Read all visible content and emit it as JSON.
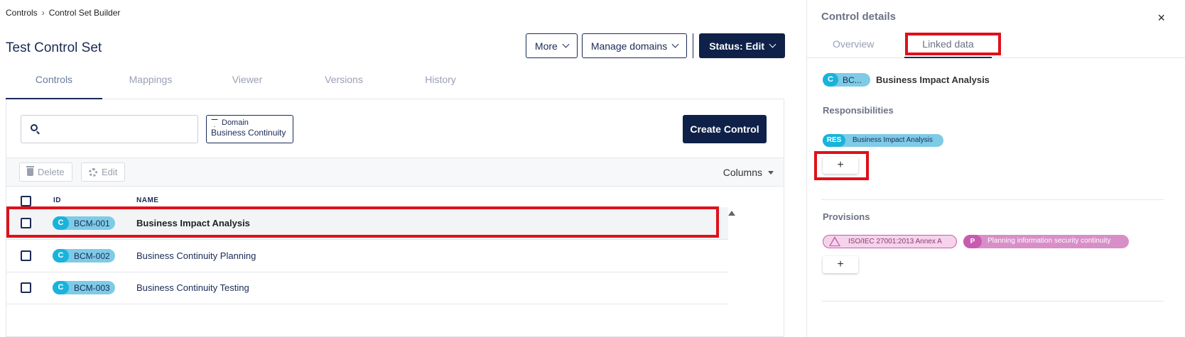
{
  "breadcrumb": {
    "root": "Controls",
    "current": "Control Set Builder"
  },
  "page": {
    "title": "Test Control Set"
  },
  "header_buttons": {
    "more": "More",
    "manage_domains": "Manage domains",
    "status": "Status: Edit"
  },
  "tabs": [
    "Controls",
    "Mappings",
    "Viewer",
    "Versions",
    "History"
  ],
  "filters": {
    "search_placeholder": "",
    "domain_label": "Domain",
    "domain_value": "Business Continuity"
  },
  "actions": {
    "create": "Create Control",
    "delete": "Delete",
    "edit": "Edit",
    "columns": "Columns"
  },
  "table": {
    "headers": {
      "id": "ID",
      "name": "NAME"
    },
    "rows": [
      {
        "badge": "C",
        "id": "BCM-001",
        "name": "Business Impact Analysis",
        "selected": true
      },
      {
        "badge": "C",
        "id": "BCM-002",
        "name": "Business Continuity Planning",
        "selected": false
      },
      {
        "badge": "C",
        "id": "BCM-003",
        "name": "Business Continuity Testing",
        "selected": false
      }
    ]
  },
  "details": {
    "title": "Control details",
    "close": "×",
    "tabs": {
      "overview": "Overview",
      "linked": "Linked data"
    },
    "control": {
      "badge": "C",
      "code": "BC...",
      "name": "Business Impact Analysis"
    },
    "responsibilities": {
      "title": "Responsibilities",
      "badge": "RES",
      "item": "Business Impact Analysis",
      "add": "+"
    },
    "provisions": {
      "title": "Provisions",
      "standard": "ISO/IEC 27001:2013 Annex A",
      "badge": "P",
      "item": "Planning information security continuity",
      "add": "+"
    }
  },
  "colors": {
    "navy": "#0f2148",
    "accent_cyan": "#19b3dc",
    "pill_cyan": "#7ecbe6",
    "provision_pink": "#c75bb0",
    "highlight_red": "#e0101a"
  }
}
